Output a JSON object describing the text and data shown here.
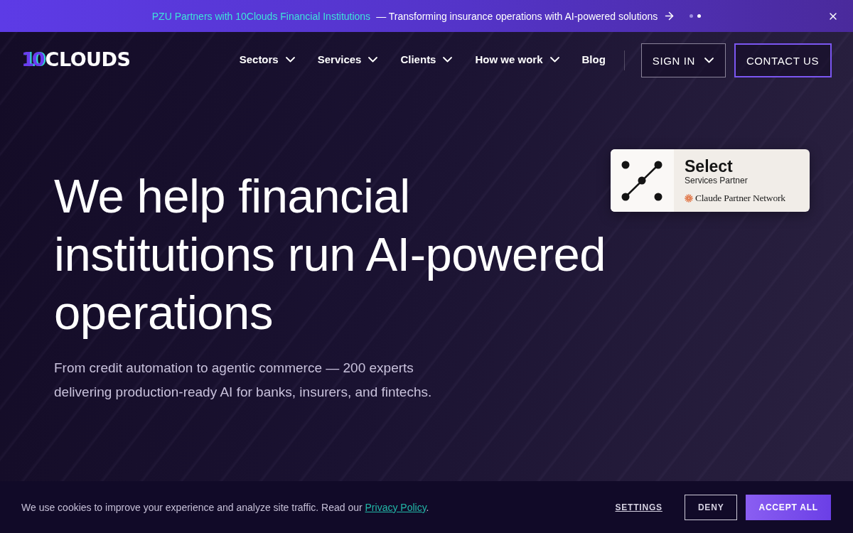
{
  "announcement": {
    "highlight": "PZU Partners with 10Clouds Financial Institutions",
    "text": "— Transforming insurance operations with AI-powered solutions",
    "dots": [
      {
        "selected": false
      },
      {
        "selected": true
      }
    ]
  },
  "header": {
    "logo": {
      "mark": "10",
      "word": "CLOUDS"
    },
    "nav": [
      {
        "label": "Sectors",
        "has_menu": true
      },
      {
        "label": "Services",
        "has_menu": true
      },
      {
        "label": "Clients",
        "has_menu": true
      },
      {
        "label": "How we work",
        "has_menu": true
      },
      {
        "label": "Blog",
        "has_menu": false
      }
    ],
    "actions": [
      {
        "label": "SIGN IN",
        "kind": "outline",
        "has_menu": true
      },
      {
        "label": "CONTACT US",
        "kind": "accent",
        "has_menu": false
      }
    ]
  },
  "hero": {
    "heading": "We help financial institutions run AI-powered operations",
    "subtitle": "From credit automation to agentic commerce — 200 experts delivering production-ready AI for banks, insurers, and fintechs.",
    "badge": {
      "title": "Select",
      "subtitle": "Services Partner",
      "network": "Claude Partner Network"
    }
  },
  "cookie_banner": {
    "text": "We use cookies to improve your experience and analyze site traffic. Read our",
    "link": "Privacy Policy",
    "end": ".",
    "buttons": [
      {
        "label": "SETTINGS",
        "kind": "link"
      },
      {
        "label": "DENY",
        "kind": "outline"
      },
      {
        "label": "ACCEPT ALL",
        "kind": "primary"
      }
    ]
  }
}
